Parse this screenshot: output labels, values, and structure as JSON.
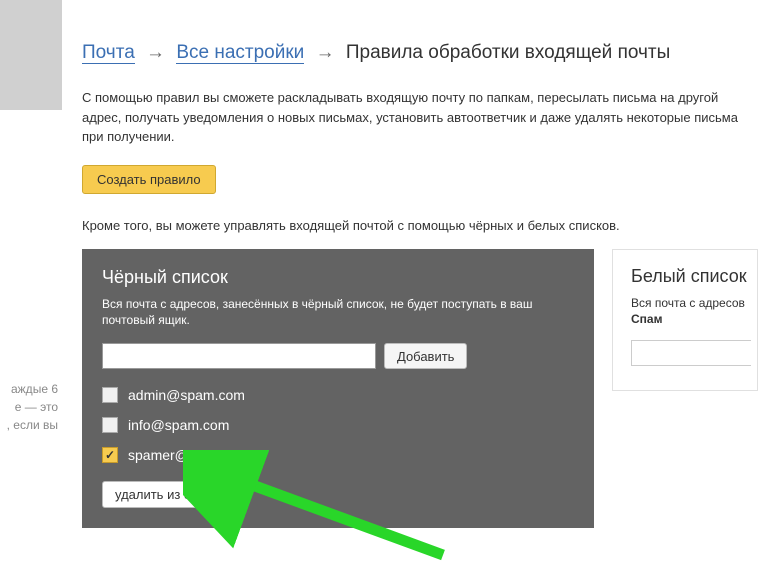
{
  "breadcrumb": {
    "mail": "Почта",
    "settings": "Все настройки",
    "current": "Правила обработки входящей почты"
  },
  "description": "С помощью правил вы сможете раскладывать входящую почту по папкам, пересылать письма на другой адрес, получать уведомления о новых письмах, установить автоответчик и даже удалять некоторые письма при получении.",
  "create_rule_label": "Создать правило",
  "sub_description": "Кроме того, вы можете управлять входящей почтой с помощью чёрных и белых списков.",
  "blacklist": {
    "title": "Чёрный список",
    "description": "Вся почта с адресов, занесённых в чёрный список, не будет поступать в ваш почтовый ящик.",
    "add_label": "Добавить",
    "input_value": "",
    "items": [
      {
        "email": "admin@spam.com",
        "checked": false
      },
      {
        "email": "info@spam.com",
        "checked": false
      },
      {
        "email": "spamer@spam.com",
        "checked": true
      }
    ],
    "remove_label": "удалить из списка"
  },
  "whitelist": {
    "title": "Белый список",
    "description_line1": "Вся почта с адресов",
    "description_line2": "Спам"
  },
  "sidebar": {
    "line1": "аждые 6",
    "line2": "е — это",
    "line3": ", если вы"
  }
}
